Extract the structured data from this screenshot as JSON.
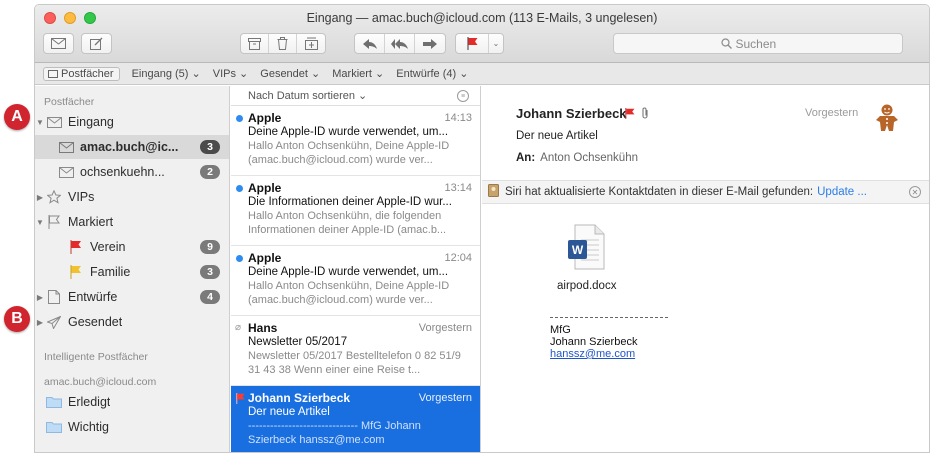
{
  "window": {
    "title": "Eingang — amac.buch@icloud.com (113 E-Mails, 3 ungelesen)"
  },
  "toolbar": {
    "search_placeholder": "Suchen",
    "buttons": [
      "get-mail-icon",
      "compose-icon",
      "archive-icon",
      "trash-icon",
      "junk-icon",
      "reply-icon",
      "reply-all-icon",
      "forward-icon",
      "flag-icon",
      "flag-menu-chevron-icon"
    ]
  },
  "favorites": {
    "mailboxes": "Postfächer",
    "inbox": "Eingang (5) ⌄",
    "vips": "VIPs ⌄",
    "sent": "Gesendet ⌄",
    "flagged": "Markiert ⌄",
    "drafts": "Entwürfe (4) ⌄"
  },
  "sidebar": {
    "section_mailboxes": "Postfächer",
    "inbox": "Eingang",
    "account1": {
      "label": "amac.buch@ic...",
      "count": "3"
    },
    "account2": {
      "label": "ochsenkuehn...",
      "count": "2"
    },
    "vips": "VIPs",
    "flagged": "Markiert",
    "verein": {
      "label": "Verein",
      "count": "9"
    },
    "familie": {
      "label": "Familie",
      "count": "3"
    },
    "drafts": {
      "label": "Entwürfe",
      "count": "4"
    },
    "sent": "Gesendet",
    "section_smart": "Intelligente Postfächer",
    "section_account": "amac.buch@icloud.com",
    "done": "Erledigt",
    "important": "Wichtig"
  },
  "list": {
    "sort_label": "Nach Datum sortieren ⌄",
    "messages": [
      {
        "sender": "Apple",
        "time": "14:13",
        "subject": "Deine Apple-ID wurde verwendet, um...",
        "preview": "Hallo Anton Ochsenkühn, Deine Apple-ID (amac.buch@icloud.com) wurde ver..."
      },
      {
        "sender": "Apple",
        "time": "13:14",
        "subject": "Die Informationen deiner Apple-ID wur...",
        "preview": "Hallo Anton Ochsenkühn, die folgenden Informationen deiner Apple-ID (amac.b..."
      },
      {
        "sender": "Apple",
        "time": "12:04",
        "subject": "Deine Apple-ID wurde verwendet, um...",
        "preview": "Hallo Anton Ochsenkühn, Deine Apple-ID (amac.buch@icloud.com) wurde ver..."
      },
      {
        "sender": "Hans",
        "time": "Vorgestern",
        "subject": "Newsletter 05/2017",
        "preview": "Newsletter 05/2017 Bestelltelefon 0 82 51/9 31 43 38  Wenn einer eine Reise t..."
      },
      {
        "sender": "Johann Szierbeck",
        "time": "Vorgestern",
        "subject": "Der neue Artikel",
        "preview": "------------------------------ MfG Johann Szierbeck hanssz@me.com"
      }
    ]
  },
  "reader": {
    "from": "Johann Szierbeck",
    "date": "Vorgestern",
    "subject": "Der neue Artikel",
    "to_label": "An:",
    "to_value": "Anton Ochsenkühn",
    "siri_text": "Siri hat aktualisierte Kontaktdaten in dieser E-Mail gefunden:",
    "siri_action": "Update ...",
    "attachment": "airpod.docx",
    "sig_line1": "MfG",
    "sig_line2": "Johann Szierbeck",
    "sig_mail": "hanssz@me.com"
  },
  "markers": {
    "a": "A",
    "b": "B"
  },
  "colors": {
    "accent": "#1a6fe0",
    "unread_dot": "#2e8cf0",
    "flag_red": "#e52a2a",
    "flag_yellow": "#f2c12e",
    "marker": "#d0242e"
  }
}
